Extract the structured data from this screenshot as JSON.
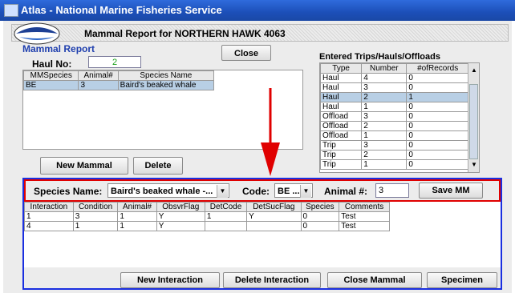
{
  "window": {
    "title": "Atlas - National Marine Fisheries Service"
  },
  "header": {
    "title": "Mammal Report for NORTHERN HAWK 4063"
  },
  "report": {
    "section_label": "Mammal Report",
    "haul_label": "Haul No:",
    "haul_value": "2",
    "close_label": "Close"
  },
  "mammal_table": {
    "columns": [
      "MMSpecies",
      "Animal#",
      "Species Name"
    ],
    "rows": [
      [
        "BE",
        "3",
        "Baird's beaked whale"
      ]
    ]
  },
  "mammal_buttons": {
    "new_label": "New Mammal",
    "delete_label": "Delete"
  },
  "trips": {
    "title": "Entered Trips/Hauls/Offloads",
    "columns": [
      "Type",
      "Number",
      "#ofRecords"
    ],
    "rows": [
      [
        "Haul",
        "4",
        "0"
      ],
      [
        "Haul",
        "3",
        "0"
      ],
      [
        "Haul",
        "2",
        "1"
      ],
      [
        "Haul",
        "1",
        "0"
      ],
      [
        "Offload",
        "3",
        "0"
      ],
      [
        "Offload",
        "2",
        "0"
      ],
      [
        "Offload",
        "1",
        "0"
      ],
      [
        "Trip",
        "3",
        "0"
      ],
      [
        "Trip",
        "2",
        "0"
      ],
      [
        "Trip",
        "1",
        "0"
      ]
    ],
    "selected_row": 2
  },
  "species_bar": {
    "species_label": "Species Name:",
    "species_value": "Baird's beaked whale -...",
    "code_label": "Code:",
    "code_value": "BE ...",
    "animal_label": "Animal #:",
    "animal_value": "3",
    "save_label": "Save MM"
  },
  "interaction_table": {
    "columns": [
      "Interaction",
      "Condition",
      "Animal#",
      "ObsvrFlag",
      "DetCode",
      "DetSucFlag",
      "Species",
      "Comments"
    ],
    "rows": [
      [
        "1",
        "3",
        "1",
        "Y",
        "1",
        "Y",
        "0",
        "Test"
      ],
      [
        "4",
        "1",
        "1",
        "Y",
        "",
        "",
        "0",
        "Test"
      ]
    ]
  },
  "bottom_buttons": {
    "new_interaction": "New Interaction",
    "delete_interaction": "Delete Interaction",
    "close_mammal": "Close Mammal",
    "specimen": "Specimen"
  },
  "colors": {
    "titlebar": "#2f6bdc",
    "highlight_red": "#e00000",
    "highlight_blue": "#1a2fe0",
    "selection": "#b8cfe5"
  }
}
